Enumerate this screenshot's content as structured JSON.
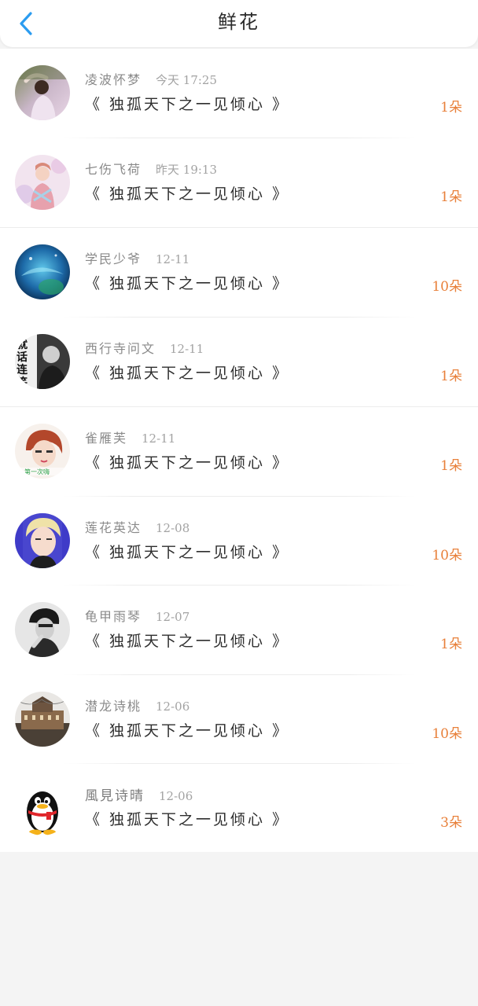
{
  "header": {
    "title": "鲜花",
    "accent_color": "#2b9cf0"
  },
  "rows": [
    {
      "user": "凌波怀梦",
      "time": "今天 17:25",
      "book": "《 独孤天下之一见倾心 》",
      "count": "1朵"
    },
    {
      "user": "七伤飞荷",
      "time": "昨天 19:13",
      "book": "《 独孤天下之一见倾心 》",
      "count": "1朵"
    },
    {
      "user": "学民少爷",
      "time": "12-11",
      "book": "《 独孤天下之一见倾心 》",
      "count": "10朵"
    },
    {
      "user": "西行寺问文",
      "time": "12-11",
      "book": "《 独孤天下之一见倾心 》",
      "count": "1朵"
    },
    {
      "user": "雀雁芙",
      "time": "12-11",
      "book": "《 独孤天下之一见倾心 》",
      "count": "1朵"
    },
    {
      "user": "莲花英达",
      "time": "12-08",
      "book": "《 独孤天下之一见倾心 》",
      "count": "10朵"
    },
    {
      "user": "龟甲雨琴",
      "time": "12-07",
      "book": "《 独孤天下之一见倾心 》",
      "count": "1朵"
    },
    {
      "user": "潜龙诗桃",
      "time": "12-06",
      "book": "《 独孤天下之一见倾心 》",
      "count": "10朵"
    },
    {
      "user": "風見诗晴",
      "time": "12-06",
      "book": "《 独孤天下之一见倾心 》",
      "count": "3朵"
    }
  ],
  "avatar_text": {
    "row4_lines": [
      "就",
      "话",
      "连",
      "笑"
    ],
    "row5_banner": "第一次嗨"
  },
  "count_color": "#e8803a"
}
